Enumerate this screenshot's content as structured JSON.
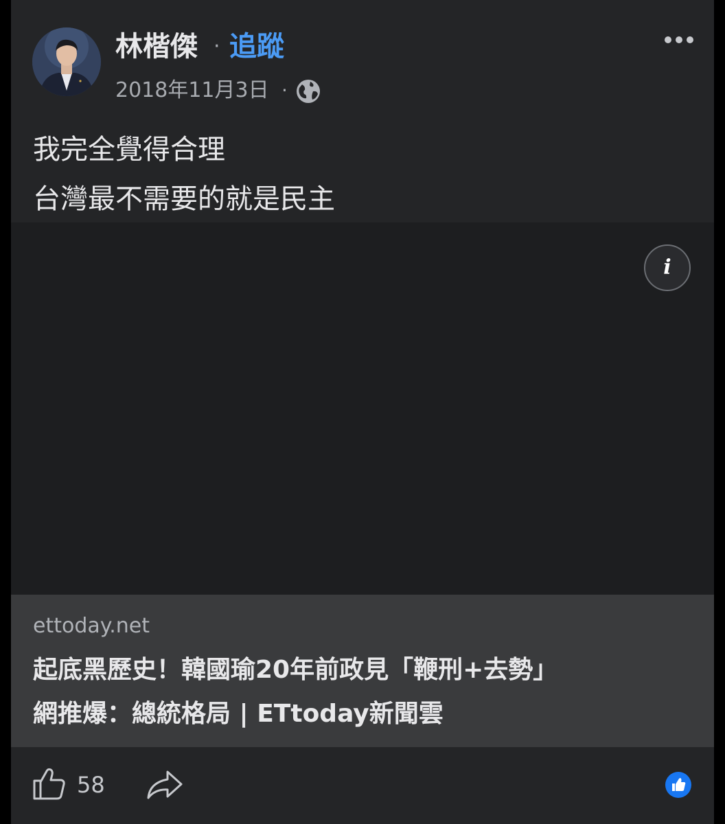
{
  "post": {
    "author_name": "林楷傑",
    "follow_label": "追蹤",
    "separator": "·",
    "date": "2018年11月3日",
    "audience_icon": "globe-icon",
    "more_icon": "more-horizontal-icon",
    "text_lines": [
      "我完全覺得合理",
      "台灣最不需要的就是民主"
    ]
  },
  "link_preview": {
    "info_icon": "info-icon",
    "domain": "ettoday.net",
    "title_lines": [
      "起底黑歷史！韓國瑜20年前政見「鞭刑+去勢」",
      "網推爆：總統格局 | ETtoday新聞雲"
    ]
  },
  "actions": {
    "like_icon": "thumbs-up-icon",
    "like_count": "58",
    "share_icon": "share-arrow-icon",
    "reaction_icon": "like-reaction-icon"
  },
  "colors": {
    "background": "#000000",
    "card": "#242527",
    "link_blue": "#4b9bf5",
    "reaction_blue": "#1877f2"
  }
}
